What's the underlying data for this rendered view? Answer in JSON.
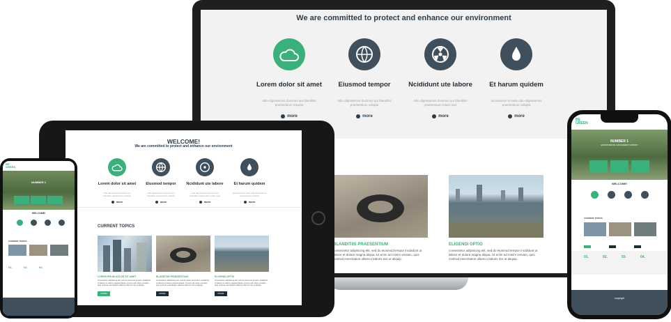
{
  "hero": {
    "welcome": "WELCOME!",
    "tagline": "We are committed to protect and enhance our environment"
  },
  "features": [
    {
      "icon": "co2-cloud-icon",
      "title": "Lorem dolor sit amet",
      "text": "odio dignissimos ducimus qui blanditiis praesentium volupta",
      "more": "more"
    },
    {
      "icon": "globe-icon",
      "title": "Eiusmod tempor",
      "text": "odio dignissimos ducimus qui blanditiis praesentium volupta",
      "more": "more"
    },
    {
      "icon": "radiation-icon",
      "title": "Ncididunt ute labore",
      "text": "odio dignissimos ducimus qui blanditiis praesentium totam ead",
      "more": "more"
    },
    {
      "icon": "water-drop-icon",
      "title": "Et harum quidem",
      "text": "accusamus et iusto odio dignissimos praesentium volupta",
      "more": "more"
    }
  ],
  "topics": {
    "heading": "CURRENT TOPICS",
    "items": [
      {
        "caption": "LOREM IPSUM DOLOR SIT AMET",
        "button": "MORE"
      },
      {
        "caption": "BLANDITIIS PRAESENTIUM",
        "button": "MORE"
      },
      {
        "caption": "ELIGENDI OPTIO",
        "button": "MORE"
      }
    ],
    "body": "consectetur adipisicing elit, sed do eiusmod tempor incididunt ut labore et dolore magna aliqua. Ut enim ad minim veniam, quis nostrud exercitation ullamco laboris nisi ut aliquip."
  },
  "mobile": {
    "logo_top": "BE",
    "logo_bottom": "GREEN",
    "banner_title": "NUMBER 1",
    "banner_sub": "ENVIRONMENTAL MANAGEMENT COMPANY",
    "welcome": "WELCOME!",
    "topics": "CURRENT TOPICS",
    "stats": [
      "01.",
      "02.",
      "03.",
      "04."
    ],
    "copyright": "copyright"
  },
  "colors": {
    "accent": "#38b27a",
    "dark": "#3f4f5c"
  }
}
